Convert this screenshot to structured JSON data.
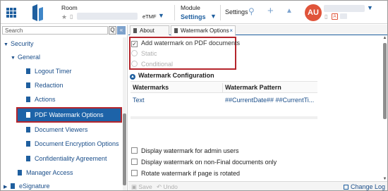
{
  "header": {
    "room_title": "Room",
    "room_tag": "eTMF",
    "module_title": "Module",
    "module_value": "Settings",
    "settings_label": "Settings",
    "user_initials": "AU",
    "user_badge": "A"
  },
  "sidebar": {
    "search_placeholder": "Search",
    "search_button": "Q",
    "collapse_button": "«",
    "items": [
      {
        "label": "Security",
        "level": 0,
        "caret": "▼"
      },
      {
        "label": "General",
        "level": 1,
        "caret": "▼"
      },
      {
        "label": "Logout Timer",
        "level": 2
      },
      {
        "label": "Redaction",
        "level": 2
      },
      {
        "label": "Actions",
        "level": 2
      },
      {
        "label": "PDF Watermark Options",
        "level": 2,
        "selected": true
      },
      {
        "label": "Document Viewers",
        "level": 2
      },
      {
        "label": "Document Encryption Options",
        "level": 2
      },
      {
        "label": "Confidentiality Agreement",
        "level": 2
      },
      {
        "label": "Manager Access",
        "level": 1
      },
      {
        "label": "eSignature",
        "level": 0,
        "caret": "▶"
      }
    ]
  },
  "tabs": [
    {
      "label": "About",
      "active": false
    },
    {
      "label": "Watermark Options",
      "active": true,
      "close": "×"
    }
  ],
  "options": {
    "add_watermark_label": "Add watermark on PDF documents",
    "add_watermark_checked": true,
    "static_label": "Static",
    "conditional_label": "Conditional"
  },
  "watermark_config": {
    "section_title": "Watermark Configuration",
    "columns": [
      "Watermarks",
      "Watermark Pattern"
    ],
    "rows": [
      {
        "watermark": "Text",
        "pattern": "##CurrentDate## ##CurrentTi..."
      }
    ]
  },
  "bottom_options": [
    {
      "label": "Display watermark for admin users",
      "checked": false
    },
    {
      "label": "Display watermark on non-Final documents only",
      "checked": false
    },
    {
      "label": "Rotate watermark if page is rotated",
      "checked": false
    }
  ],
  "footer": {
    "save_label": "Save",
    "undo_label": "Undo",
    "change_log_label": "Change Log"
  },
  "colors": {
    "brand_blue": "#1f5f9f",
    "selection_blue": "#1d63a8",
    "highlight_red": "#b5252c",
    "avatar_red": "#e0543a"
  }
}
